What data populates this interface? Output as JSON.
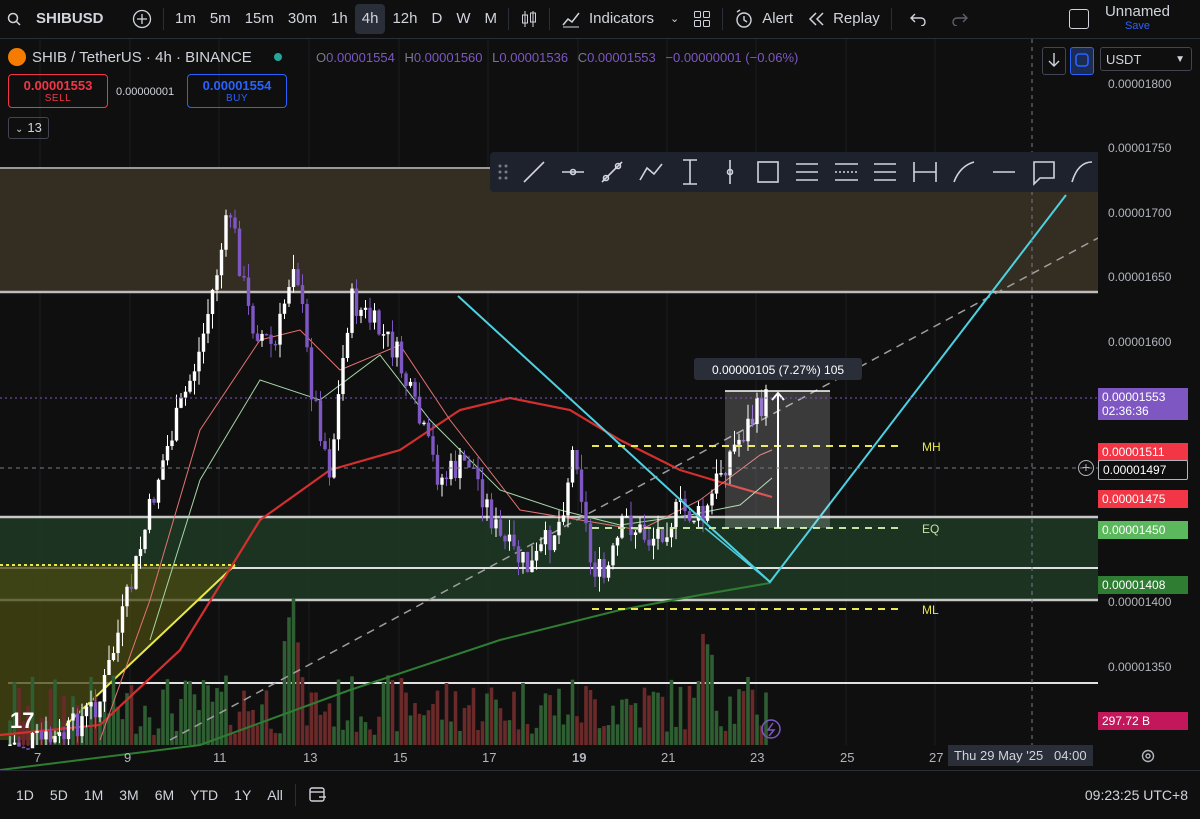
{
  "toolbar": {
    "symbol": "SHIBUSD",
    "intervals": [
      "1m",
      "5m",
      "15m",
      "30m",
      "1h",
      "4h",
      "12h",
      "D",
      "W",
      "M"
    ],
    "active_interval": "4h",
    "indicators_label": "Indicators",
    "alert_label": "Alert",
    "replay_label": "Replay",
    "layout_name": "Unnamed",
    "layout_save": "Save"
  },
  "legend": {
    "title": "SHIB / TetherUS · 4h · BINANCE",
    "o_label": "O",
    "o": "0.00001554",
    "h_label": "H",
    "h": "0.00001560",
    "l_label": "L",
    "l": "0.00001536",
    "c_label": "C",
    "c": "0.00001553",
    "change": "−0.00000001 (−0.06%)",
    "sell_price": "0.00001553",
    "sell_label": "SELL",
    "spread": "0.00000001",
    "buy_price": "0.00001554",
    "buy_label": "BUY",
    "indicator_count": "13"
  },
  "price_axis": {
    "currency": "USDT",
    "ticks": [
      "0.00001800",
      "0.00001750",
      "0.00001700",
      "0.00001650",
      "0.00001600",
      "0.00001400",
      "0.00001350"
    ],
    "badges": [
      {
        "value": "0.00001553",
        "sub": "02:36:36",
        "color": "#7e57c2"
      },
      {
        "value": "0.00001511",
        "color": "#f23645"
      },
      {
        "value": "0.00001497",
        "color": "#0f0f0f"
      },
      {
        "value": "0.00001475",
        "color": "#f23645"
      },
      {
        "value": "0.00001450",
        "color": "#5cb85c"
      },
      {
        "value": "0.00001408",
        "color": "#2e7d32"
      },
      {
        "value": "297.72 B",
        "color": "#c2185b"
      }
    ]
  },
  "annotations": {
    "measure": "0.00000105 (7.27%) 105",
    "mh": "MH",
    "eq": "EQ",
    "ml": "ML"
  },
  "time_axis": {
    "labels": [
      "7",
      "9",
      "11",
      "13",
      "15",
      "17",
      "19",
      "21",
      "23",
      "25",
      "27"
    ],
    "crosshair": "Thu 29 May '25   04:00"
  },
  "bottom": {
    "ranges": [
      "1D",
      "5D",
      "1M",
      "3M",
      "6M",
      "YTD",
      "1Y",
      "All"
    ],
    "clock": "09:23:25 UTC+8"
  },
  "colors": {
    "up": "#ffffff",
    "down": "#7e57c2",
    "accent": "#2962ff",
    "sell": "#f23645",
    "buy": "#2962ff"
  }
}
